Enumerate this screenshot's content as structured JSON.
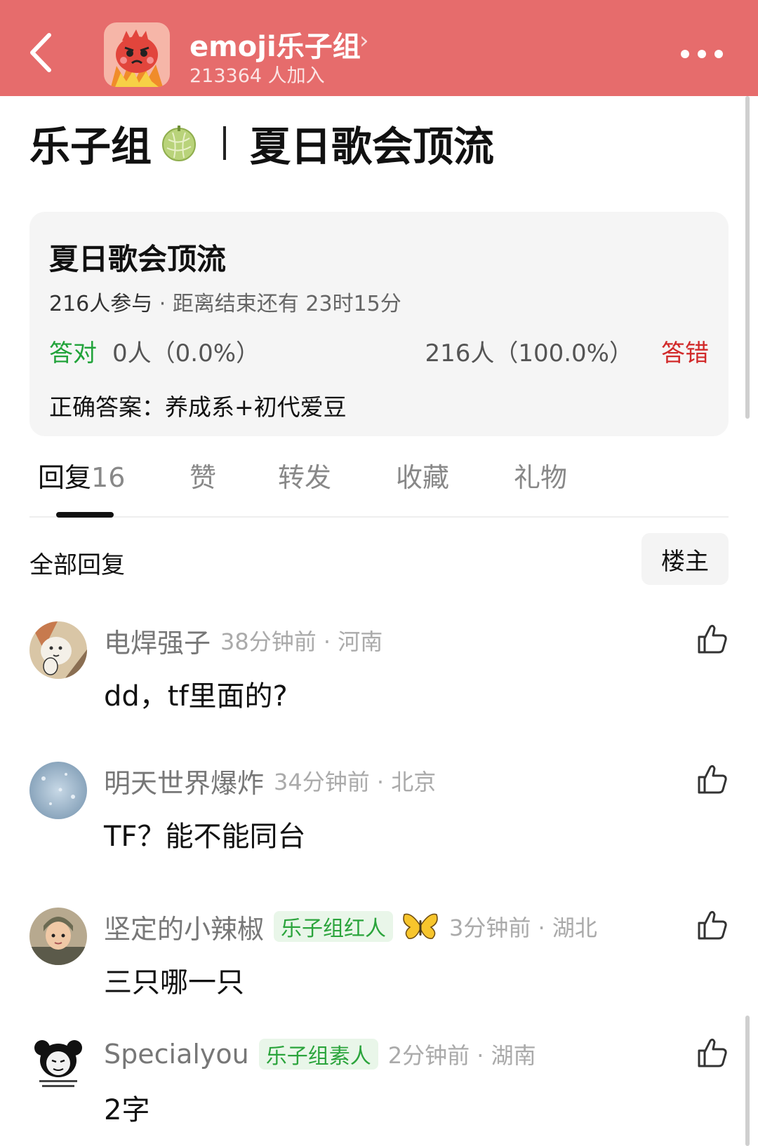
{
  "header": {
    "group_name": "emoji乐子组",
    "chevron": "›",
    "members": "213364 人加入",
    "background_color": "#e66c6c"
  },
  "post": {
    "title_prefix": "乐子组",
    "title_emoji": "melon-emoji",
    "title_main": "夏日歌会顶流"
  },
  "poll": {
    "title": "夏日歌会顶流",
    "participants": "216人参与",
    "separator": " · ",
    "deadline": "距离结束还有 23时15分",
    "right_label": "答对",
    "right_count": "0人（0.0%）",
    "wrong_count": "216人（100.0%）",
    "wrong_label": "答错",
    "answer": "正确答案：养成系+初代爱豆",
    "right_color": "#21a33a",
    "wrong_color": "#d12a2a"
  },
  "tabs": [
    {
      "label": "回复",
      "count": "16",
      "active": true
    },
    {
      "label": "赞"
    },
    {
      "label": "转发"
    },
    {
      "label": "收藏"
    },
    {
      "label": "礼物"
    }
  ],
  "replies": {
    "title": "全部回复",
    "filter_label": "楼主"
  },
  "comments": [
    {
      "username": "电焊强子",
      "time_loc": "38分钟前 · 河南",
      "text": "dd，tf里面的?"
    },
    {
      "username": "明天世界爆炸",
      "time_loc": "34分钟前 · 北京",
      "text": "TF？能不能同台"
    },
    {
      "username": "坚定的小辣椒",
      "badge": "乐子组红人",
      "decoration": "butterfly-icon",
      "time_loc": "3分钟前 · 湖北",
      "text": "三只哪一只"
    },
    {
      "username": "Specialyou",
      "badge": "乐子组素人",
      "time_loc": "2分钟前 · 湖南",
      "text": "2字"
    }
  ]
}
